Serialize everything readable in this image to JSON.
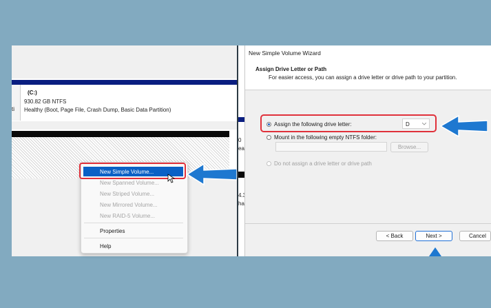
{
  "disk_management": {
    "volume": {
      "name": "(C:)",
      "size": "930.82 GB NTFS",
      "status": "Healthy (Boot, Page File, Crash Dump, Basic Data Partition)",
      "left_fragment": "ti"
    },
    "context_menu": {
      "items": [
        {
          "label": "New Simple Volume...",
          "state": "highlighted"
        },
        {
          "label": "New Spanned Volume...",
          "state": "disabled"
        },
        {
          "label": "New Striped Volume...",
          "state": "disabled"
        },
        {
          "label": "New Mirrored Volume...",
          "state": "disabled"
        },
        {
          "label": "New RAID-5 Volume...",
          "state": "disabled"
        },
        {
          "label": "Properties",
          "state": "enabled"
        },
        {
          "label": "Help",
          "state": "enabled"
        }
      ]
    },
    "behind_fragments": [
      "0",
      "ea",
      "4.3",
      "hal"
    ]
  },
  "wizard": {
    "title": "New Simple Volume Wizard",
    "heading": "Assign Drive Letter or Path",
    "subheading": "For easier access, you can assign a drive letter or drive path to your partition.",
    "options": {
      "assign_letter": "Assign the following drive letter:",
      "mount_folder": "Mount in the following empty NTFS folder:",
      "no_assign": "Do not assign a drive letter or drive path"
    },
    "drive_letter": "D",
    "browse_label": "Browse...",
    "buttons": {
      "back": "< Back",
      "next": "Next >",
      "cancel": "Cancel"
    }
  },
  "colors": {
    "background": "#82aac0",
    "highlight_border": "#e0303a",
    "menu_selection": "#0a60c5",
    "arrow": "#1e78d0"
  }
}
